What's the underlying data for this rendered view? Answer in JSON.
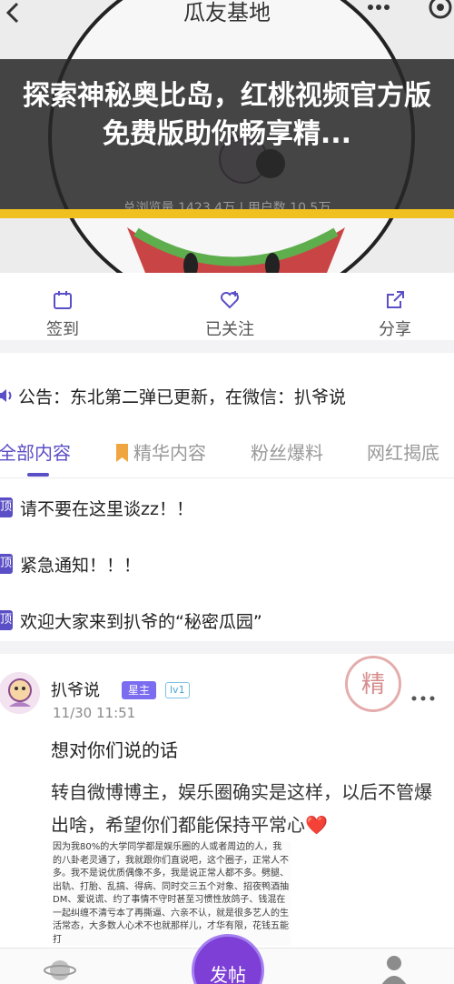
{
  "header": {
    "title": "瓜友基地",
    "back_icon": "chevron-left-icon",
    "more_icon": "more-dots-icon",
    "target_icon": "target-icon"
  },
  "overlay": {
    "headline": "探索神秘奥比岛，红桃视频官方版免费版助你畅享精..."
  },
  "stats": {
    "text": "总浏览量 1423.4万 | 用户数 10.5万"
  },
  "actions": [
    {
      "label": "签到",
      "icon": "calendar-icon"
    },
    {
      "label": "已关注",
      "icon": "heart-plus-icon"
    },
    {
      "label": "分享",
      "icon": "share-icon"
    }
  ],
  "notice": {
    "icon": "speaker-icon",
    "text": "公告：东北第二弹已更新，在微信：扒爷说"
  },
  "tabs": [
    {
      "label": "全部内容",
      "active": true
    },
    {
      "label": "精华内容",
      "icon": "bookmark-icon"
    },
    {
      "label": "粉丝爆料"
    },
    {
      "label": "网红揭底"
    }
  ],
  "pinned": {
    "badge": "顶",
    "items": [
      "请不要在这里谈zz！！",
      "紧急通知！！！",
      "欢迎大家来到扒爷的“秘密瓜园”"
    ]
  },
  "post": {
    "author": "扒爷说",
    "badge_role": "星主",
    "badge_level": "lv1",
    "time": "11/30 11:51",
    "stamp": "精",
    "title": "想对你们说的话",
    "body": "转自微博博主，娱乐圈确实是这样，以后不管爆出啥，希望你们都能保持平常心",
    "body_emoji": "❤️",
    "image_text": "因为我80%的大学同学都是娱乐圈的人或者周边的人，我的八卦老灵通了，我就跟你们直说吧，这个圈子，正常人不多。我不是说优质偶像不多，我是说正常人都不多。劈腿、出轨、打胎、乱搞、得病、同时交三五个对象、招夜鸭酒抽DM、爱说谎、约了事情不守时甚至习惯性放鸽子、钱混在一起纠缠不清亏本了再撕逼、六亲不认，就是很多艺人的生活常态，大多数人心术不也就那样儿，才华有限，花钱五能打"
  },
  "bottom_bar": {
    "post_button": "发帖",
    "left_icon": "planet-icon",
    "right_icon": "user-icon"
  }
}
